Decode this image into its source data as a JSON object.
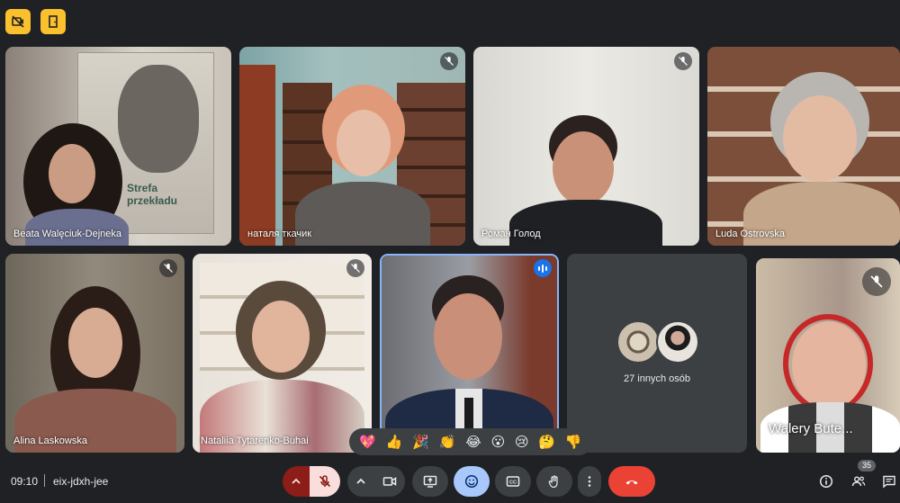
{
  "topbar": {
    "camera_off_icon": "video-off-icon",
    "door_icon": "exit-door-icon",
    "accent": "#fbc02d"
  },
  "participants": [
    {
      "name": "Beata Walęciuk-Dejneka",
      "muted": false
    },
    {
      "name": "наталя ткачик",
      "muted": true
    },
    {
      "name": "Роман Голод",
      "muted": true
    },
    {
      "name": "Luda Ostrovska",
      "muted": false
    },
    {
      "name": "Alina Laskowska",
      "muted": true
    },
    {
      "name": "Nataliia Tytarenko-Buhai",
      "muted": true
    },
    {
      "name": "",
      "speaking": true
    },
    {
      "name": "Walery Bute...",
      "muted": true
    }
  ],
  "poster": {
    "line1": "Strefa",
    "line2": "przekładu"
  },
  "others": {
    "label": "27 innych osób"
  },
  "reactions": [
    "💖",
    "👍",
    "🎉",
    "👏",
    "😂",
    "😮",
    "😢",
    "🤔",
    "👎"
  ],
  "meeting": {
    "time": "09:10",
    "separator": "|",
    "code": "eix-jdxh-jee"
  },
  "controls": {
    "mic": "mic-off-icon",
    "camera": "video-icon",
    "present": "present-screen-icon",
    "emoji": "emoji-icon",
    "captions": "captions-icon",
    "hand": "raise-hand-icon",
    "more": "more-vertical-icon",
    "hangup": "hang-up-icon",
    "hangup_color": "#ea4335",
    "emoji_active_color": "#a8c7fa"
  },
  "right_panel": {
    "people_count": "35"
  }
}
